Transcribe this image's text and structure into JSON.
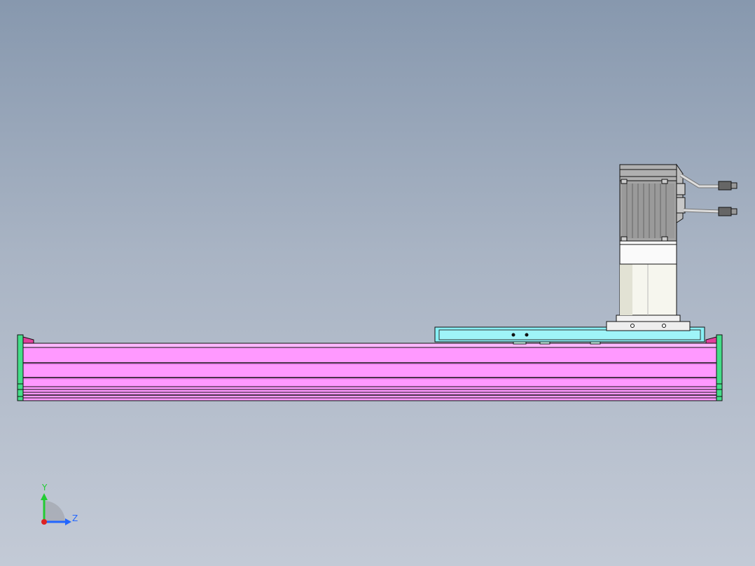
{
  "viewport": {
    "background_top": "#8798ae",
    "background_bottom": "#c3cad6"
  },
  "model": {
    "rail_color": "#ff99ff",
    "end_cap_color": "#44dd88",
    "carriage_color": "#88f0f5",
    "motor_color": "#999999",
    "reducer_color": "#f2f2ea",
    "outline_color": "#111111"
  },
  "triad": {
    "y_label": "Y",
    "z_label": "Z",
    "y_color": "#22cc33",
    "z_color": "#2266ff",
    "x_color": "#dd2222"
  }
}
